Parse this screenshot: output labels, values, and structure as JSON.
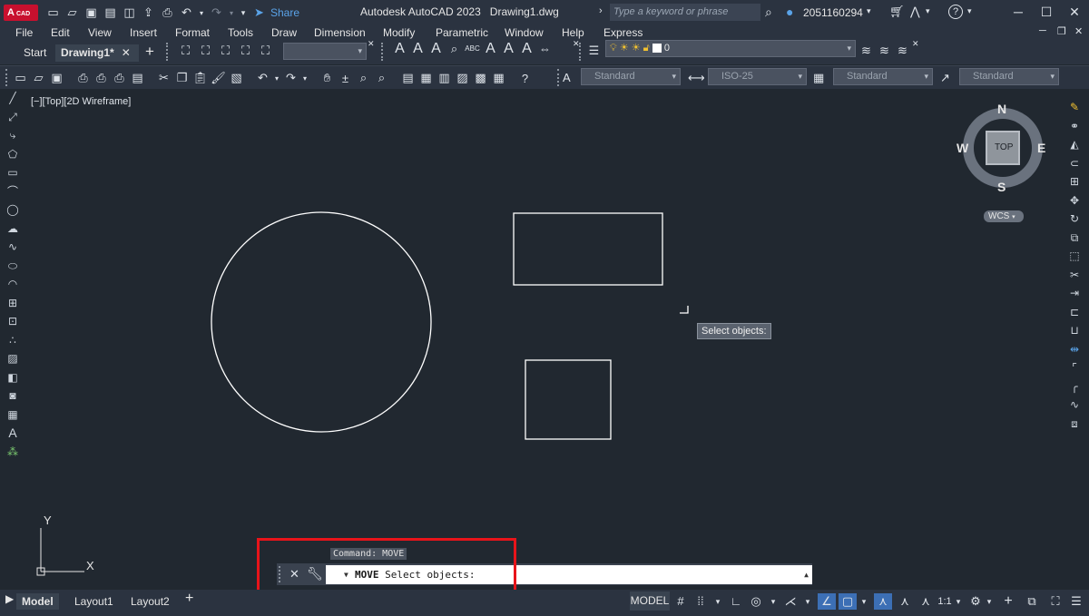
{
  "app": {
    "logo_text": "A",
    "logo_sub": "CAD",
    "title": "Autodesk AutoCAD 2023",
    "document": "Drawing1.dwg",
    "share_label": "Share"
  },
  "search": {
    "placeholder": "Type a keyword or phrase"
  },
  "user": {
    "id": "2051160294"
  },
  "menus": [
    "File",
    "Edit",
    "View",
    "Insert",
    "Format",
    "Tools",
    "Draw",
    "Dimension",
    "Modify",
    "Parametric",
    "Window",
    "Help",
    "Express"
  ],
  "file_tabs": [
    {
      "label": "Start"
    },
    {
      "label": "Drawing1*"
    }
  ],
  "layer": {
    "value": "0"
  },
  "styles": {
    "text": "Standard",
    "dim": "ISO-25",
    "table": "Standard",
    "mleader": "Standard"
  },
  "viewport": {
    "label": "[−][Top][2D Wireframe]"
  },
  "viewcube": {
    "north": "N",
    "south": "S",
    "east": "E",
    "west": "W",
    "face": "TOP",
    "wcs": "WCS"
  },
  "ucs": {
    "x": "X",
    "y": "Y"
  },
  "tooltip": "Select objects:",
  "command": {
    "history": "Command: MOVE",
    "name": "MOVE",
    "prompt": "Select objects:"
  },
  "layout_tabs": [
    "Model",
    "Layout1",
    "Layout2"
  ],
  "status": {
    "model": "MODEL",
    "scale": "1:1"
  },
  "colors": {
    "background": "#212830",
    "chrome": "#2b3340",
    "highlight": "#e8141a",
    "accent": "#3c6fb5"
  }
}
